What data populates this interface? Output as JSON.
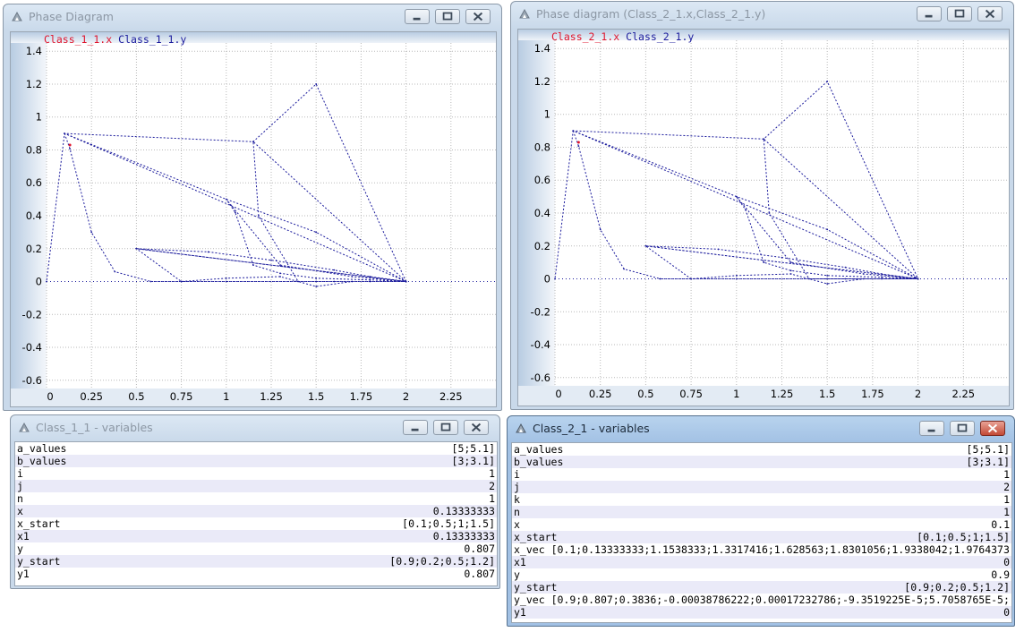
{
  "windows": {
    "phase1": {
      "title": "Phase Diagram",
      "legend": [
        "Class_1_1.x",
        "Class_1_1.y"
      ]
    },
    "phase2": {
      "title": "Phase diagram (Class_2_1.x,Class_2_1.y)",
      "legend": [
        "Class_2_1.x",
        "Class_2_1.y"
      ]
    },
    "vars1": {
      "title": "Class_1_1 - variables",
      "rows": [
        {
          "name": "a_values",
          "value": "[5;5.1]"
        },
        {
          "name": "b_values",
          "value": "[3;3.1]"
        },
        {
          "name": "i",
          "value": "1"
        },
        {
          "name": "j",
          "value": "2"
        },
        {
          "name": "n",
          "value": "1"
        },
        {
          "name": "x",
          "value": "0.13333333"
        },
        {
          "name": "x_start",
          "value": "[0.1;0.5;1;1.5]"
        },
        {
          "name": "x1",
          "value": "0.13333333"
        },
        {
          "name": "y",
          "value": "0.807"
        },
        {
          "name": "y_start",
          "value": "[0.9;0.2;0.5;1.2]"
        },
        {
          "name": "y1",
          "value": "0.807"
        }
      ]
    },
    "vars2": {
      "title": "Class_2_1 - variables",
      "rows": [
        {
          "name": "a_values",
          "value": "[5;5.1]"
        },
        {
          "name": "b_values",
          "value": "[3;3.1]"
        },
        {
          "name": "i",
          "value": "1"
        },
        {
          "name": "j",
          "value": "2"
        },
        {
          "name": "k",
          "value": "1"
        },
        {
          "name": "n",
          "value": "1"
        },
        {
          "name": "x",
          "value": "0.1"
        },
        {
          "name": "x_start",
          "value": "[0.1;0.5;1;1.5]"
        },
        {
          "name": "x_vec",
          "value": "[0.1;0.13333333;1.1538333;1.3317416;1.628563;1.8301056;1.9338042;1.9764373",
          "wide": true
        },
        {
          "name": "x1",
          "value": "0"
        },
        {
          "name": "y",
          "value": "0.9"
        },
        {
          "name": "y_start",
          "value": "[0.9;0.2;0.5;1.2]"
        },
        {
          "name": "y_vec",
          "value": "[0.9;0.807;0.3836;-0.00038786222;0.00017232786;-9.3519225E-5;5.7058765E-5;",
          "wide": true
        },
        {
          "name": "y1",
          "value": "0"
        }
      ]
    }
  },
  "chart_data": [
    {
      "type": "line",
      "title": "",
      "series": [
        {
          "name": "Class_1_1.x vs Class_1_1.y",
          "points": [
            [
              0.1,
              0.9
            ],
            [
              0.13,
              0.807
            ],
            [
              0.25,
              0.3
            ],
            [
              0.38,
              0.06
            ],
            [
              0.58,
              0
            ],
            [
              0.75,
              0
            ],
            [
              1.0,
              0
            ],
            [
              1.5,
              0
            ],
            [
              1.8,
              0
            ],
            [
              2.0,
              0
            ],
            [
              1.9,
              0.01
            ],
            [
              1.7,
              0.03
            ],
            [
              1.3,
              0.1
            ],
            [
              1.0,
              0.5
            ],
            [
              1.05,
              0.42
            ],
            [
              1.15,
              0.1
            ],
            [
              1.3,
              0.05
            ],
            [
              1.5,
              0.02
            ],
            [
              1.8,
              0.01
            ],
            [
              2.0,
              0
            ],
            [
              0.5,
              0.2
            ],
            [
              0.75,
              0
            ],
            [
              1.0,
              0.02
            ],
            [
              1.3,
              0.03
            ],
            [
              1.5,
              -0.03
            ],
            [
              1.7,
              0
            ],
            [
              2.0,
              0
            ],
            [
              0.5,
              0.2
            ],
            [
              0.9,
              0.18
            ],
            [
              1.25,
              0.13
            ],
            [
              1.6,
              0.07
            ],
            [
              1.8,
              0.03
            ],
            [
              2.0,
              0
            ],
            [
              1.15,
              0.85
            ],
            [
              1.18,
              0.4
            ],
            [
              1.4,
              0.0
            ],
            [
              1.6,
              0.0
            ],
            [
              2.0,
              0
            ],
            [
              1.5,
              1.2
            ],
            [
              1.15,
              0.85
            ],
            [
              0.1,
              0.9
            ],
            [
              1.0,
              0.5
            ],
            [
              1.5,
              0.3
            ],
            [
              2.0,
              0
            ],
            [
              0.1,
              0.9
            ],
            [
              0.0,
              0
            ]
          ]
        }
      ],
      "xlabel": "",
      "ylabel": "",
      "x_ticks": [
        "0",
        "0.25",
        "0.5",
        "0.75",
        "1",
        "1.25",
        "1.5",
        "1.75",
        "2",
        "2.25"
      ],
      "y_ticks": [
        "1.4",
        "1.2",
        "1",
        "0.8",
        "0.6",
        "0.4",
        "0.2",
        "0",
        "-0.2",
        "-0.4",
        "-0.6"
      ],
      "xlim": [
        0,
        2.5
      ],
      "ylim": [
        -0.65,
        1.45
      ],
      "grid": true
    },
    {
      "type": "line",
      "title": "",
      "series": [
        {
          "name": "Class_2_1.x vs Class_2_1.y",
          "points": [
            [
              0.1,
              0.9
            ],
            [
              0.13,
              0.807
            ],
            [
              0.25,
              0.3
            ],
            [
              0.38,
              0.06
            ],
            [
              0.58,
              0
            ],
            [
              0.75,
              0
            ],
            [
              1.0,
              0
            ],
            [
              1.5,
              0
            ],
            [
              1.8,
              0
            ],
            [
              2.0,
              0
            ],
            [
              1.9,
              0.01
            ],
            [
              1.7,
              0.03
            ],
            [
              1.3,
              0.1
            ],
            [
              1.0,
              0.5
            ],
            [
              1.05,
              0.42
            ],
            [
              1.15,
              0.1
            ],
            [
              1.3,
              0.05
            ],
            [
              1.5,
              0.02
            ],
            [
              1.8,
              0.01
            ],
            [
              2.0,
              0
            ],
            [
              0.5,
              0.2
            ],
            [
              0.75,
              0
            ],
            [
              1.0,
              0.02
            ],
            [
              1.3,
              0.03
            ],
            [
              1.5,
              -0.03
            ],
            [
              1.7,
              0
            ],
            [
              2.0,
              0
            ],
            [
              0.5,
              0.2
            ],
            [
              0.9,
              0.18
            ],
            [
              1.25,
              0.13
            ],
            [
              1.6,
              0.07
            ],
            [
              1.8,
              0.03
            ],
            [
              2.0,
              0
            ],
            [
              1.15,
              0.85
            ],
            [
              1.18,
              0.4
            ],
            [
              1.4,
              0.0
            ],
            [
              1.6,
              0.0
            ],
            [
              2.0,
              0
            ],
            [
              1.5,
              1.2
            ],
            [
              1.15,
              0.85
            ],
            [
              0.1,
              0.9
            ],
            [
              1.0,
              0.5
            ],
            [
              1.5,
              0.3
            ],
            [
              2.0,
              0
            ],
            [
              0.1,
              0.9
            ],
            [
              0.0,
              0
            ]
          ]
        }
      ],
      "xlabel": "",
      "ylabel": "",
      "x_ticks": [
        "0",
        "0.25",
        "0.5",
        "0.75",
        "1",
        "1.25",
        "1.5",
        "1.75",
        "2",
        "2.25"
      ],
      "y_ticks": [
        "1.4",
        "1.2",
        "1",
        "0.8",
        "0.6",
        "0.4",
        "0.2",
        "0",
        "-0.2",
        "-0.4",
        "-0.6"
      ],
      "xlim": [
        0,
        2.5
      ],
      "ylim": [
        -0.65,
        1.45
      ],
      "grid": true
    }
  ],
  "colors": {
    "curve": "#1a1a9c",
    "legend_x": "#e0142c",
    "legend_y": "#1a1a9c",
    "grid": "#b9b9b9",
    "alt_row": "#eaeaf8"
  }
}
